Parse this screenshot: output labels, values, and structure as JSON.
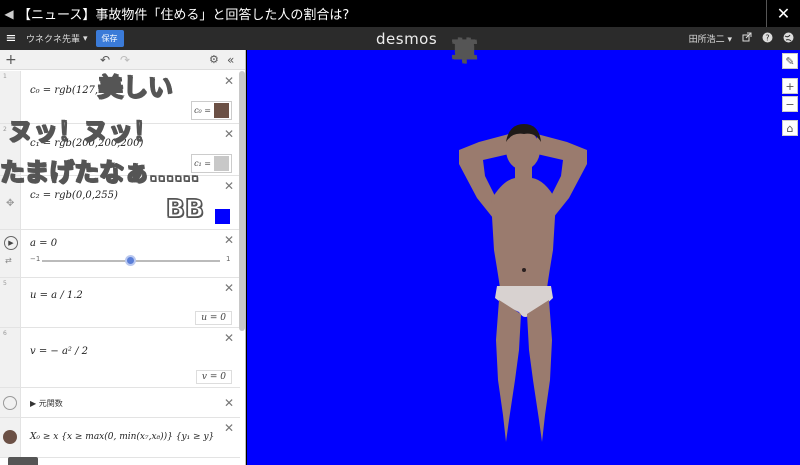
{
  "ticker": {
    "left_chevron": "◀",
    "text": "【ニュース】事故物件「住める」と回答した人の割合は?",
    "close": "✕"
  },
  "header": {
    "menu_icon": "≡",
    "graph_title": "ウネクネ先輩",
    "graph_title_chevron": "▾",
    "save_label": "保存",
    "logo": "desmos",
    "user_name": "田所浩二",
    "user_chevron": "▾"
  },
  "panel": {
    "add_icon": "+",
    "undo_icon": "↶",
    "redo_icon": "↷",
    "gear_icon": "⚙",
    "collapse_icon": "«",
    "expressions": [
      {
        "num": "1",
        "latex": "c₀ = rgb(127,93",
        "swatch_label": "c₀ =",
        "swatch_color": "#6b5045"
      },
      {
        "num": "2",
        "latex": "c₁ = rgb(200,200,200)",
        "swatch_label": "c₁ =",
        "swatch_color": "#c8c8c8"
      },
      {
        "num": "3",
        "latex": "c₂ = rgb(0,0,255)",
        "swatch_label": "",
        "swatch_color": "#0000ff"
      },
      {
        "num": "4",
        "latex": "a = 0",
        "slider_min": "−1",
        "slider_max": "1",
        "slider_value": 0
      },
      {
        "num": "5",
        "latex": "u = a / 1.2",
        "value_label": "u = 0"
      },
      {
        "num": "6",
        "latex": "v = − a² / 2",
        "value_label": "v = 0"
      },
      {
        "num": "7",
        "folder_label": "元関数"
      },
      {
        "num": "8",
        "latex": "X₀ ≥ x {x ≥ max(0, min(x₇,x₈))} {y₁ ≥ y}"
      }
    ]
  },
  "graph": {
    "background": "#0000ff",
    "skin_color": "#9a7b6e",
    "underwear_color": "#d8d2d0",
    "hair_color": "#1e1a18"
  },
  "danmaku": [
    {
      "text": "草"
    },
    {
      "text": "美しい"
    },
    {
      "text": "ヌッ！ヌッ！"
    },
    {
      "text": "たまげたなぁ……"
    },
    {
      "text": "BB"
    }
  ]
}
